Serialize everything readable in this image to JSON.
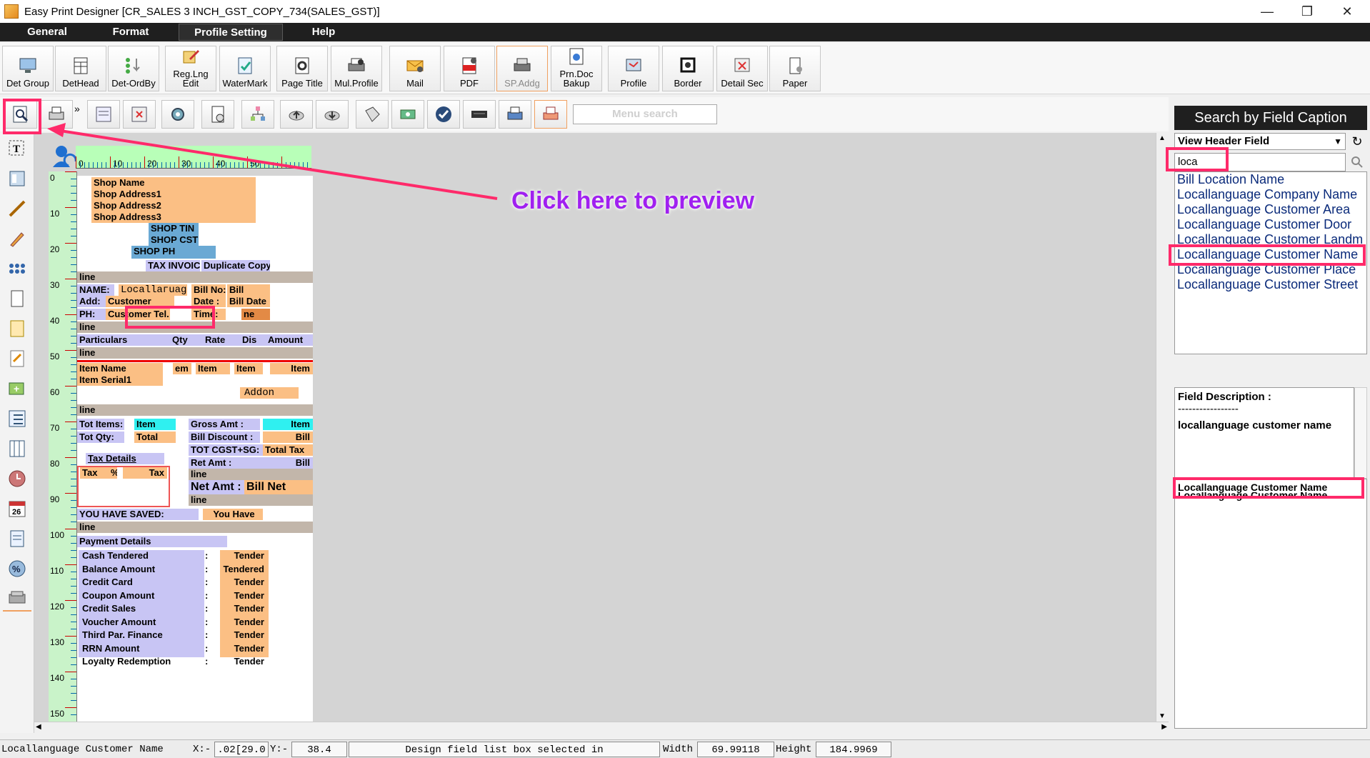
{
  "window": {
    "title": "Easy Print Designer [CR_SALES 3 INCH_GST_COPY_734(SALES_GST)]"
  },
  "menu": [
    "General",
    "Format",
    "Profile Setting",
    "Help"
  ],
  "toolbar1": [
    "Det Group",
    "DetHead",
    "Det-OrdBy",
    "Reg.Lng\nEdit",
    "WaterMark",
    "Page Title",
    "Mul.Profile",
    "Mail",
    "PDF",
    "SP.Addg",
    "Prn.Doc\nBakup",
    "Profile",
    "Border",
    "Detail Sec",
    "Paper"
  ],
  "menu_search_placeholder": "Menu search",
  "annotation": "Click here to preview",
  "ruler": {
    "h": [
      "0",
      "10",
      "20",
      "30",
      "40",
      "50"
    ],
    "v": [
      "0",
      "10",
      "20",
      "30",
      "40",
      "50",
      "60",
      "70",
      "80",
      "90",
      "100",
      "110",
      "120",
      "130",
      "140",
      "150"
    ]
  },
  "design": {
    "shop_name": "Shop Name",
    "shop_address1": "Shop Address1",
    "shop_address2": "Shop Address2",
    "shop_address3": "Shop Address3",
    "shop_tin": "SHOP TIN",
    "shop_cst": "SHOP CST",
    "shop_ph": "SHOP PH",
    "tax_invoice": "TAX INVOICE",
    "duplicate_copy": "Duplicate Copy",
    "line": "line",
    "name_label": "NAME:",
    "name_value": "Locallaгuag",
    "add_label": "Add:",
    "add_value": "Customer",
    "ph_label": "PH:",
    "ph_value": "Customer Tel.",
    "bill_no_label": "Bill No:",
    "bill_no_value": "Bill",
    "date_label": "Date   :",
    "date_value": "Bill Date",
    "time_label": "Time:",
    "time_value": "ne",
    "col_particulars": "Particulars",
    "col_qty": "Qty",
    "col_rate": "Rate",
    "col_dis": "Dis",
    "col_amount": "Amount",
    "item_name": "Item Name",
    "item_em": "em",
    "item_1": "Item",
    "item_2": "Item",
    "item_3": "Item",
    "item_serial": "Item Serial1",
    "addon": "Addon",
    "tot_items_label": "Tot Items:",
    "tot_items_value": "Item",
    "tot_qty_label": "Tot Qty:",
    "tot_qty_value": "Total",
    "gross_amt_label": "Gross Amt :",
    "gross_amt_value": "Item",
    "bill_discount_label": "Bill Discount :",
    "bill_discount_value": "Bill",
    "tot_cgst_label": "TOT CGST+SG:",
    "tot_cgst_value": "Total Tax",
    "ret_amt_label": "Ret Amt :",
    "ret_amt_value": "Bill",
    "tax_details": "Tax Details",
    "tax_col1": "Tax",
    "tax_col2": "%",
    "tax_col3": "Tax",
    "net_amt_label": "Net Amt :",
    "net_amt_value": "Bill Net",
    "you_saved_label": "YOU HAVE SAVED:",
    "you_saved_value": "You Have",
    "payment_details": "Payment Details",
    "payments": [
      {
        "label": "Cash Tendered",
        "value": "Tender"
      },
      {
        "label": "Balance Amount",
        "value": "Tendered"
      },
      {
        "label": "Credit Card",
        "value": "Tender"
      },
      {
        "label": "Coupon Amount",
        "value": "Tender"
      },
      {
        "label": "Credit Sales",
        "value": "Tender"
      },
      {
        "label": "Voucher Amount",
        "value": "Tender"
      },
      {
        "label": "Third Par. Finance",
        "value": "Tender"
      },
      {
        "label": "RRN Amount",
        "value": "Tender"
      },
      {
        "label": "Loyalty Redemption",
        "value": "Tender"
      }
    ],
    "colon": ":"
  },
  "right_panel": {
    "title": "Search by Field Caption",
    "view_select": "View Header Field",
    "search_value": "loca",
    "results": [
      "Bill Location Name",
      "Locallanguage Company Name",
      "Locallanguage Customer Area",
      "Locallanguage Customer Door",
      "Locallanguage Customer Landm",
      "Locallanguage Customer Name",
      "Locallanguage Customer Place",
      "Locallanguage Customer Street"
    ],
    "field_desc_title": "Field Description :",
    "field_desc_dashes": "-----------------",
    "field_desc_text": "locallanguage customer name",
    "selected_field": "Locallanguage Customer Name",
    "selected_field_dup": "Locallanguage Customer Name"
  },
  "status": {
    "field": "Locallanguage Customer Name",
    "x_label": "X:-",
    "x_value": ".02[29.0",
    "y_label": "Y:-",
    "y_value": "38.4",
    "message": "Design field list box selected in",
    "width_label": "Width",
    "width_value": "69.99118",
    "height_label": "Height",
    "height_value": "184.9969"
  },
  "colors": {
    "highlight_red": "#ff2a6a",
    "annotation_purple": "#a020f0",
    "field_orange": "#fbbf84",
    "field_blue": "#c8c5f4"
  }
}
